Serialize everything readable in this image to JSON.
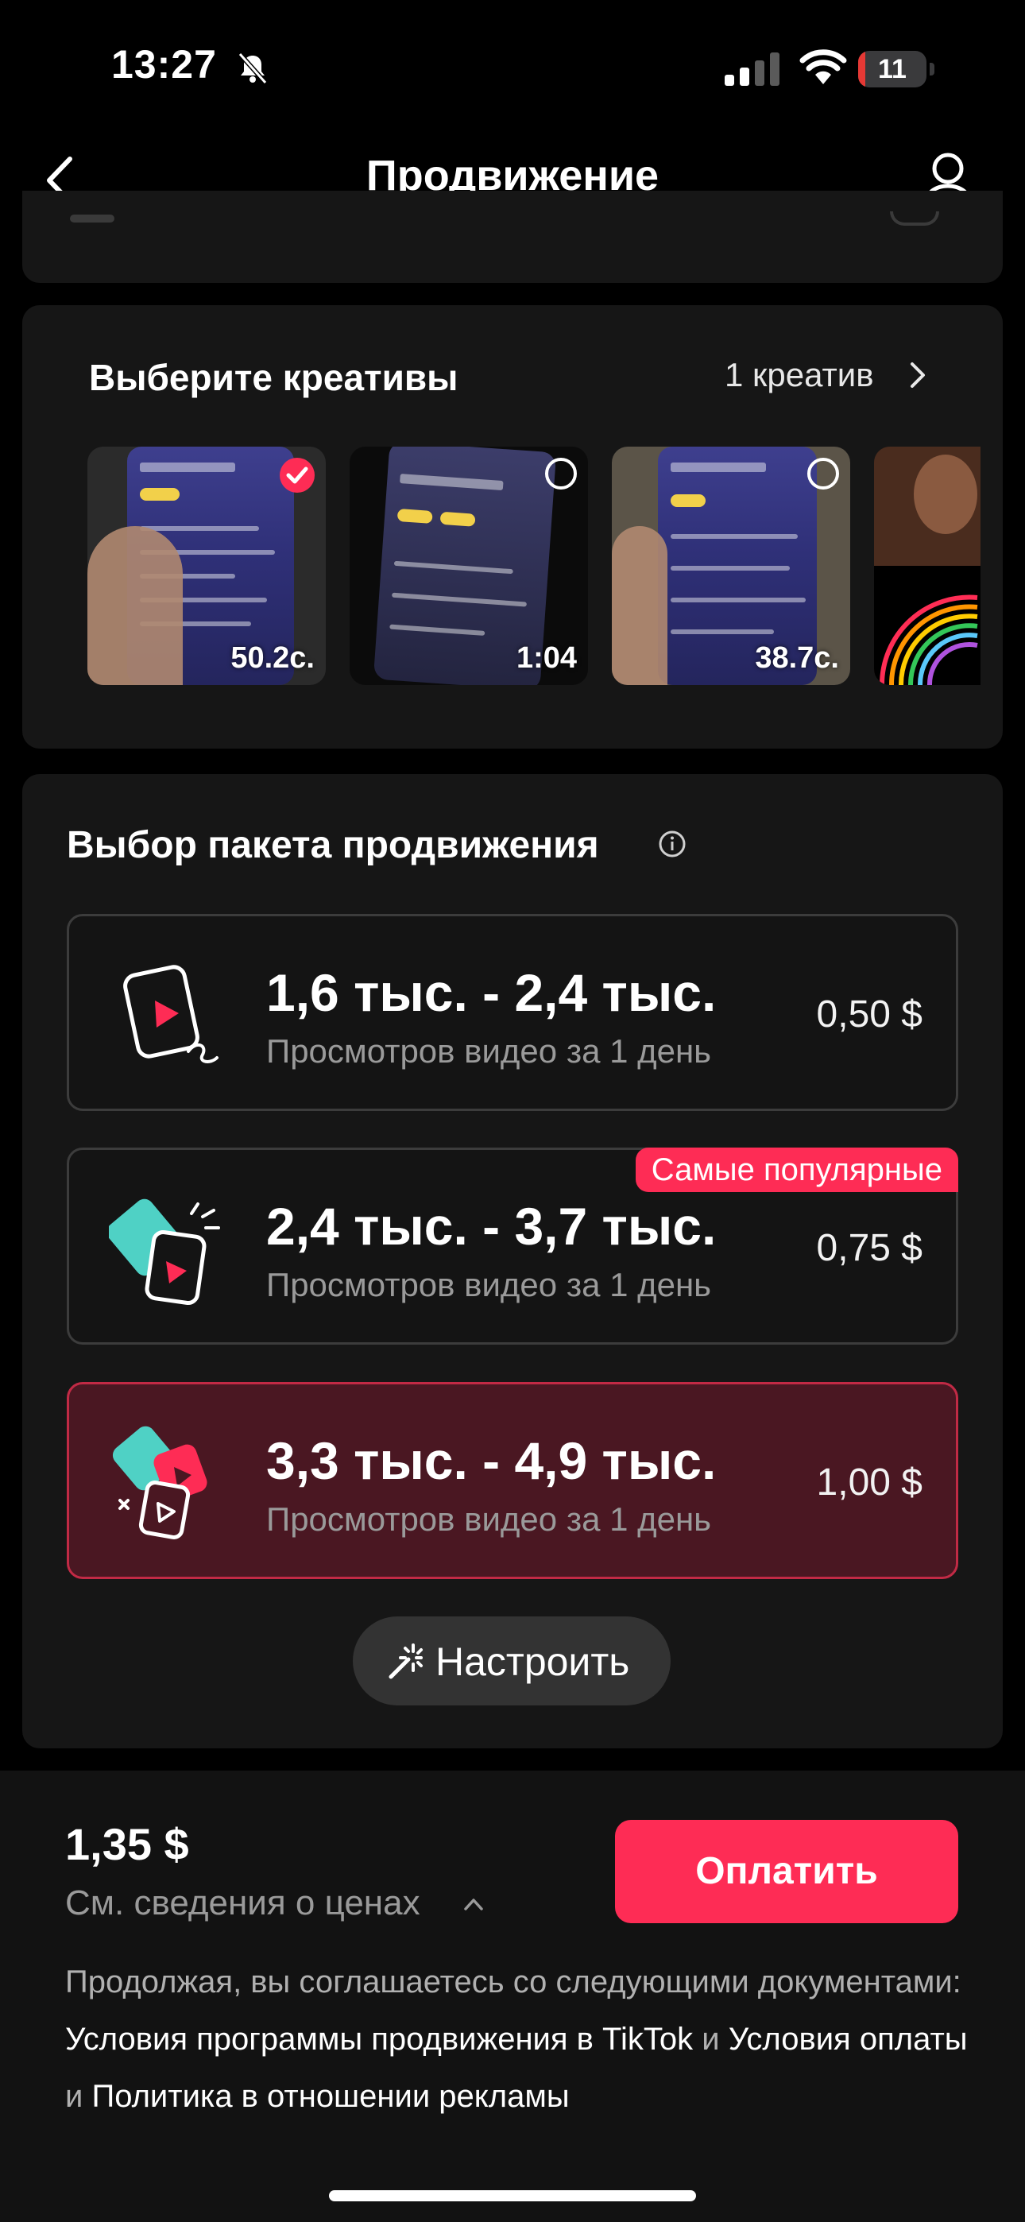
{
  "status_bar": {
    "time": "13:27",
    "battery_level": "11",
    "battery_fraction": 0.11,
    "icons": [
      "bell-slash-icon",
      "cellular-signal-icon",
      "wifi-icon",
      "battery-icon"
    ]
  },
  "nav": {
    "title": "Продвижение",
    "back_icon": "chevron-left-icon",
    "profile_icon": "person-icon"
  },
  "creatives": {
    "title": "Выберите креативы",
    "count_label": "1 креатив",
    "items": [
      {
        "duration": "50.2с.",
        "selected": true
      },
      {
        "duration": "1:04",
        "selected": false
      },
      {
        "duration": "38.7с.",
        "selected": false
      },
      {
        "duration": "",
        "selected": false
      }
    ]
  },
  "package": {
    "title": "Выбор пакета продвижения",
    "options": [
      {
        "range": "1,6 тыс. - 2,4 тыс.",
        "subtitle": "Просмотров видео за 1 день",
        "price": "0,50 $",
        "badge": "",
        "selected": false
      },
      {
        "range": "2,4 тыс. - 3,7 тыс.",
        "subtitle": "Просмотров видео за 1 день",
        "price": "0,75 $",
        "badge": "Самые популярные",
        "selected": false
      },
      {
        "range": "3,3 тыс. - 4,9 тыс.",
        "subtitle": "Просмотров видео за 1 день",
        "price": "1,00 $",
        "badge": "",
        "selected": true
      }
    ],
    "customize_label": "Настроить"
  },
  "footer": {
    "total": "1,35 $",
    "price_details": "См. сведения о ценах",
    "pay_label": "Оплатить",
    "legal_prefix": "Продолжая, вы соглашаетесь со следующими документами: ",
    "legal_link_1": "Условия программы продвижения в TikTok",
    "legal_and_1": " и ",
    "legal_link_2": "Условия оплаты",
    "legal_and_2": " и ",
    "legal_link_3": "Политика в отношении рекламы"
  },
  "colors": {
    "accent": "#fe2c55",
    "background": "#000000",
    "card": "#161616",
    "selected_card": "#4a1722",
    "teal": "#4fd1c5"
  }
}
